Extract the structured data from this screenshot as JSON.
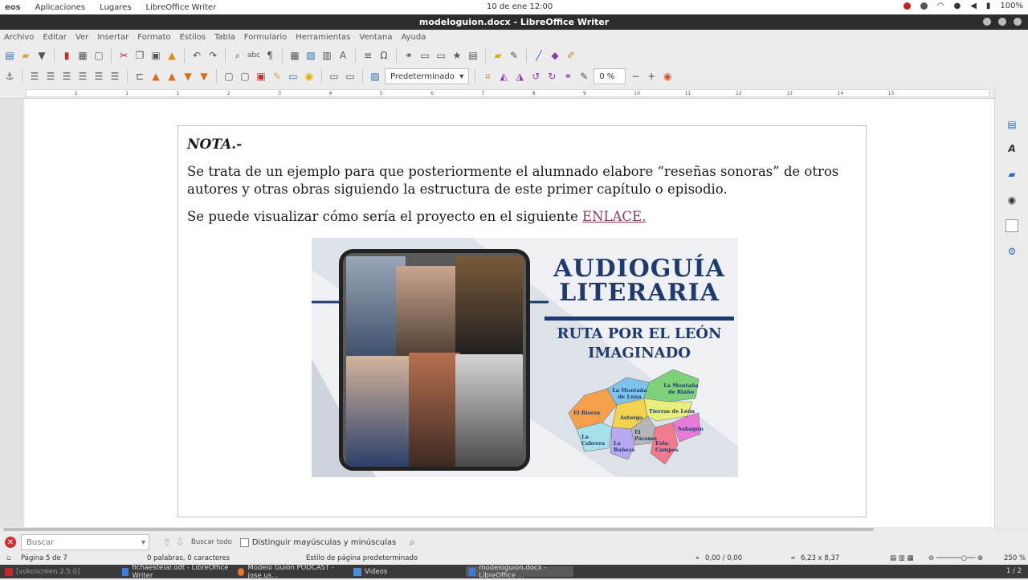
{
  "os_panel": {
    "logo": "eos",
    "menus": [
      "Aplicaciones",
      "Lugares",
      "LibreOffice Writer"
    ],
    "clock": "10 de ene  12:00",
    "battery": "100%"
  },
  "window": {
    "title": "modeloguion.docx - LibreOffice Writer"
  },
  "menubar": [
    "Archivo",
    "Editar",
    "Ver",
    "Insertar",
    "Formato",
    "Estilos",
    "Tabla",
    "Formulario",
    "Herramientas",
    "Ventana",
    "Ayuda"
  ],
  "toolbar2": {
    "frame_style": "Predeterminado",
    "transparency": "0 %"
  },
  "ruler_marks": [
    "2",
    "1",
    "1",
    "2",
    "3",
    "4",
    "5",
    "6",
    "7",
    "8",
    "9",
    "10",
    "11",
    "12",
    "13",
    "14",
    "15"
  ],
  "document": {
    "nota": "NOTA.-",
    "para1": "Se trata de un ejemplo para que posteriormente el alumnado elabore “reseñas sonoras” de otros autores y otras obras siguiendo la estructura de este primer capítulo o episodio.",
    "para2_prefix": "Se puede visualizar cómo sería el proyecto en el siguiente ",
    "para2_link": "ENLACE.",
    "figure": {
      "title_line1": "AUDIOGUÍA",
      "title_line2": "LITERARIA",
      "subtitle_line1": "RUTA POR EL LEÓN",
      "subtitle_line2": "IMAGINADO",
      "map_regions": [
        "La Montaña de Luna",
        "La Montaña de Riaño",
        "El Bierzo",
        "Astorga",
        "Tierras de León",
        "La Cabrera",
        "El Páramo",
        "La Bañeza",
        "Esla-Campos",
        "Sahagún"
      ]
    }
  },
  "findbar": {
    "placeholder": "Buscar",
    "find_all": "Buscar todo",
    "match_case": "Distinguir mayúsculas y minúsculas"
  },
  "statusbar": {
    "page": "Página 5 de 7",
    "words": "0 palabras, 0 caracteres",
    "page_style": "Estilo de página predeterminado",
    "position": "0,00 / 0,00",
    "size": "6,23 x 8,37",
    "zoom": "250 %"
  },
  "taskbar": {
    "items": [
      "[vokoscreen 2.5.0]",
      "fichaestelar.odt - LibreOffice Writer",
      "Modelo Guión PODCAST - jose.us...",
      "Videos",
      "modeloguion.docx - LibreOffice ..."
    ],
    "pager": "1 / 2"
  },
  "colors": {
    "accent_link": "#8a3a63",
    "figure_title": "#1f3b6e",
    "titlebar": "#2c2c2c"
  }
}
